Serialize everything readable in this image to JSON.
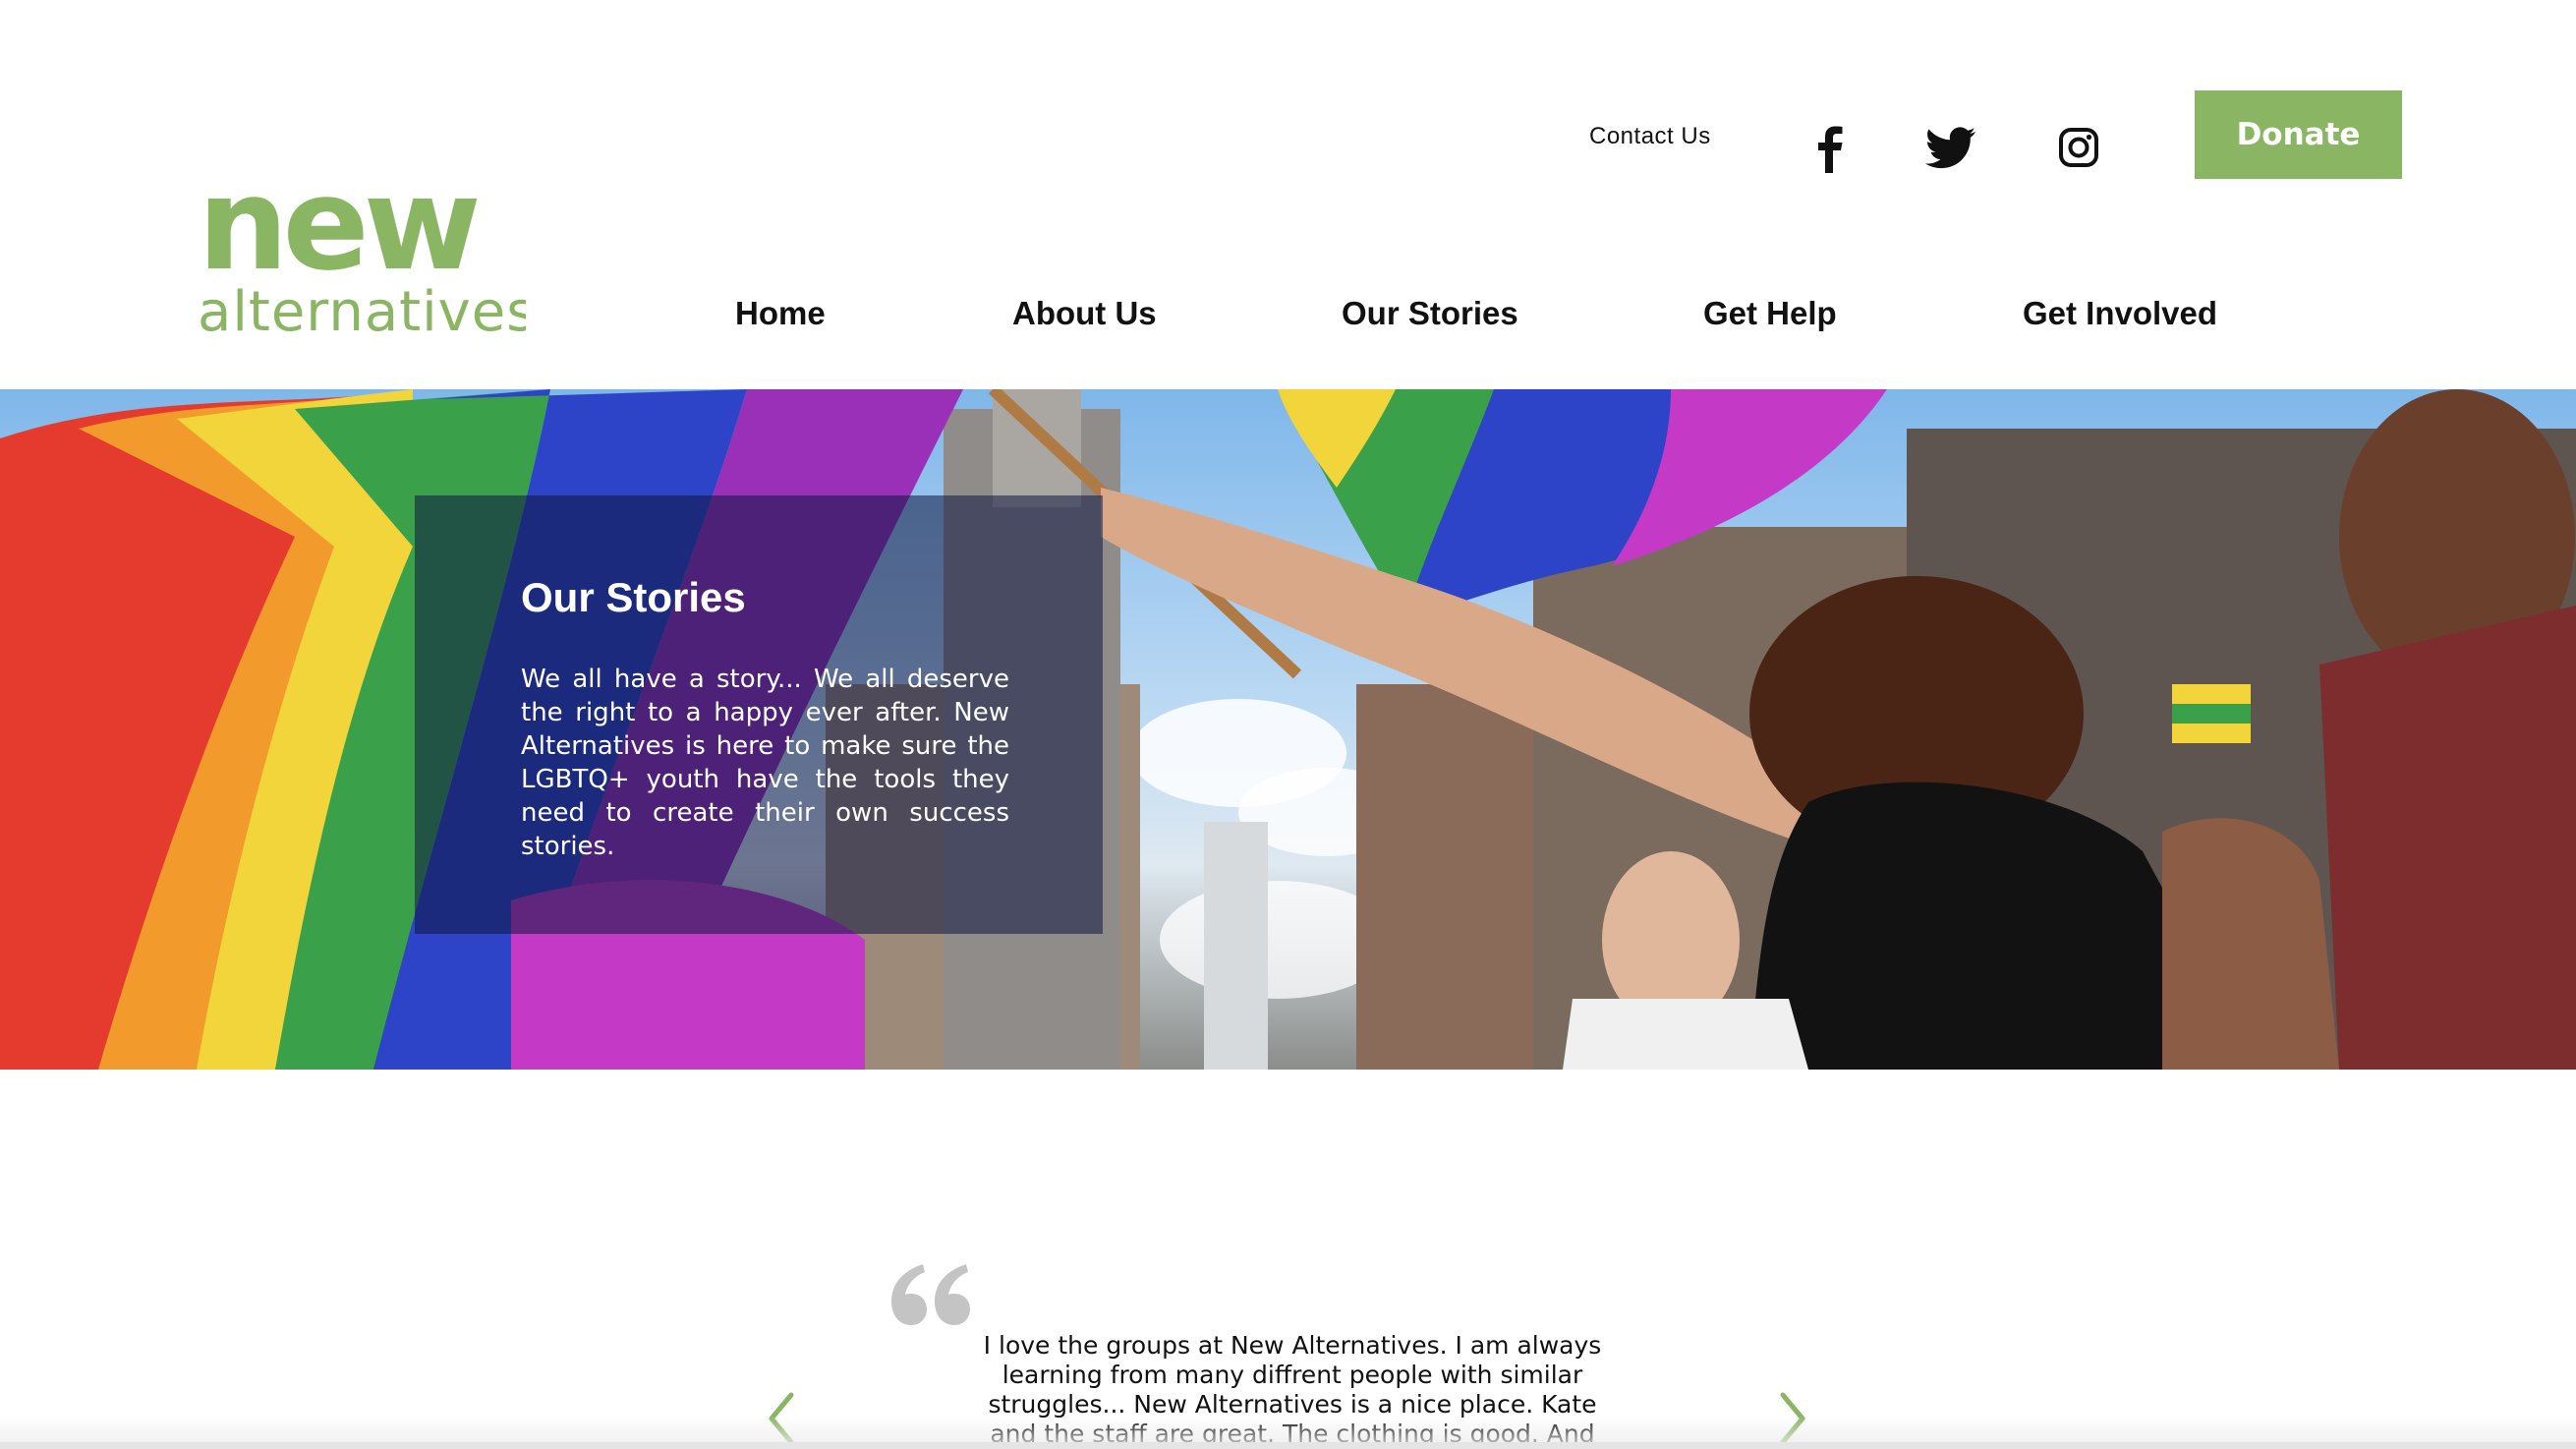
{
  "brand": {
    "logo_word_top": "new",
    "logo_word_bottom": "alternatives",
    "logo_color": "#8ab563"
  },
  "header": {
    "contact_label": "Contact Us",
    "social_icons": [
      "facebook-icon",
      "twitter-icon",
      "instagram-icon"
    ],
    "donate_label": "Donate",
    "donate_color": "#8ab563"
  },
  "nav": {
    "items": [
      {
        "label": "Home"
      },
      {
        "label": "About Us"
      },
      {
        "label": "Our Stories"
      },
      {
        "label": "Get Help"
      },
      {
        "label": "Get Involved"
      }
    ]
  },
  "hero": {
    "title": "Our Stories",
    "text": "We all have a story... We all deserve the right to a happy ever after. New Alternatives is here to make sure the LGBTQ+ youth have the tools they need to create their own success stories."
  },
  "testimonial": {
    "quote_icon": "quote-icon",
    "text": "I love the groups at New Alternatives. I am always learning from many diffrent people with similar struggles... New Alternatives is a nice place. Kate and the staff are great. The clothing is good. And",
    "prev_icon": "chevron-left-icon",
    "next_icon": "chevron-right-icon",
    "arrow_color": "#8ab563"
  }
}
